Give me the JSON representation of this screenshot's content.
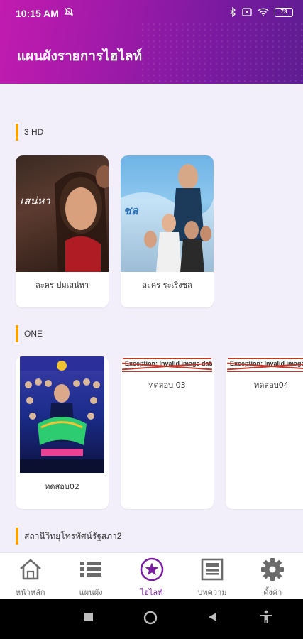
{
  "status_bar": {
    "time": "10:15 AM",
    "battery": "73"
  },
  "header": {
    "title": "แผนผังรายการไฮไลท์"
  },
  "sections": [
    {
      "label": "3 HD",
      "cards": [
        {
          "caption": "ละคร ปมเสน่หา",
          "poster_title": "เสน่หา"
        },
        {
          "caption": "ละคร ระเริงชล",
          "poster_title": "ชล"
        }
      ]
    },
    {
      "label": "ONE",
      "cards": [
        {
          "caption": "ทดสอบ02",
          "poster_title": ""
        },
        {
          "caption": "ทดสอบ 03",
          "error": "Exception: Invalid image data"
        },
        {
          "caption": "ทดสอบ04",
          "error": "Exception: Invalid image data"
        }
      ]
    },
    {
      "label": "สถานีวิทยุโทรทัศน์รัฐสภา2"
    }
  ],
  "bottom_nav": [
    {
      "label": "หน้าหลัก",
      "icon": "home-icon"
    },
    {
      "label": "แผนผัง",
      "icon": "list-icon"
    },
    {
      "label": "ไฮไลท์",
      "icon": "star-icon",
      "active": true
    },
    {
      "label": "บทความ",
      "icon": "article-icon"
    },
    {
      "label": "ตั้งค่า",
      "icon": "gear-icon"
    }
  ],
  "colors": {
    "accent": "#7b1fa2",
    "section_bar": "#f2a60c",
    "header_start": "#c21bb0",
    "header_end": "#5e1c92"
  }
}
